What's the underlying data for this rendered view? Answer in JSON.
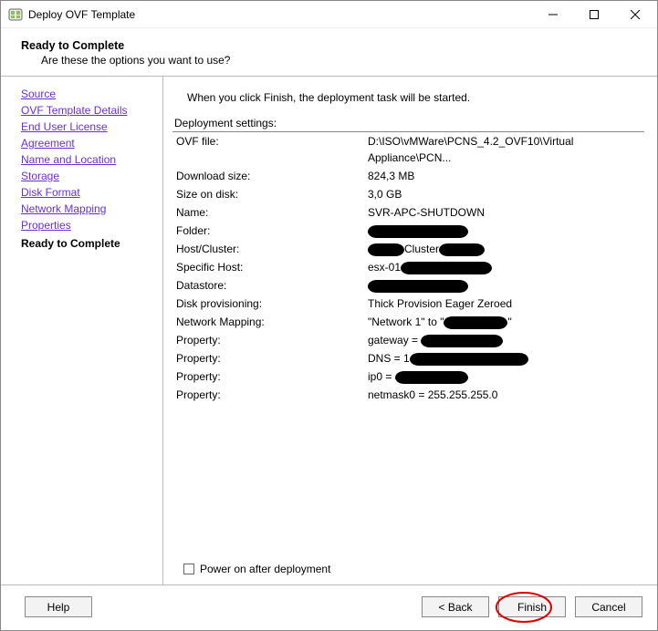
{
  "window": {
    "title": "Deploy OVF Template"
  },
  "header": {
    "title": "Ready to Complete",
    "subtitle": "Are these the options you want to use?"
  },
  "sidebar": {
    "items": [
      {
        "label": "Source"
      },
      {
        "label": "OVF Template Details"
      },
      {
        "label": "End User License Agreement"
      },
      {
        "label": "Name and Location"
      },
      {
        "label": "Storage"
      },
      {
        "label": "Disk Format"
      },
      {
        "label": "Network Mapping"
      },
      {
        "label": "Properties"
      }
    ],
    "current": "Ready to Complete"
  },
  "main": {
    "instruction": "When you click Finish, the deployment task will be started.",
    "settings_label": "Deployment settings:",
    "rows": [
      {
        "k": "OVF file:",
        "v": "D:\\ISO\\vMWare\\PCNS_4.2_OVF10\\Virtual Appliance\\PCN..."
      },
      {
        "k": "Download size:",
        "v": "824,3 MB"
      },
      {
        "k": "Size on disk:",
        "v": "3,0 GB"
      },
      {
        "k": "Name:",
        "v": "SVR-APC-SHUTDOWN"
      },
      {
        "k": "Folder:",
        "v_redacted": true,
        "v": ""
      },
      {
        "k": "Host/Cluster:",
        "v_prefix_redact": 40,
        "v_mid": "Cluster",
        "v_suffix_redact": 50
      },
      {
        "k": "Specific Host:",
        "v_prefix": "esx-01",
        "v_suffix_redact": 100
      },
      {
        "k": "Datastore:",
        "v_redacted": true
      },
      {
        "k": "Disk provisioning:",
        "v": "Thick Provision Eager Zeroed"
      },
      {
        "k": "Network Mapping:",
        "v_prefix": "\"Network 1\" to \"",
        "v_suffix_redact": 70,
        "v_suffix": "\""
      },
      {
        "k": "Property:",
        "v_prefix": "gateway = ",
        "v_suffix_redact": 90
      },
      {
        "k": "Property:",
        "v_prefix": "DNS = 1",
        "v_suffix_redact": 130
      },
      {
        "k": "Property:",
        "v_prefix": "ip0 = ",
        "v_suffix_redact": 80
      },
      {
        "k": "Property:",
        "v": "netmask0 = 255.255.255.0"
      }
    ],
    "power_on_label": "Power on after deployment",
    "power_on_checked": false
  },
  "footer": {
    "help": "Help",
    "back": "< Back",
    "finish": "Finish",
    "cancel": "Cancel"
  }
}
